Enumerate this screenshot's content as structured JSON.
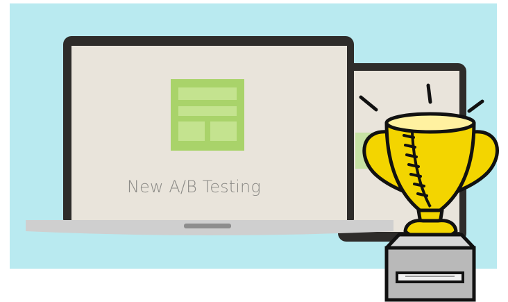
{
  "colors": {
    "sky": "#b9eaf0",
    "device_frame": "#2e2c2a",
    "screen": "#e9e4db",
    "laptop_base": "#cfcfcf",
    "template_green": "#a9d36a",
    "trophy_gold": "#f3d500",
    "trophy_outline": "#111111",
    "pedestal": "#b9b9b9"
  },
  "icons": [
    "laptop-icon",
    "tablet-icon",
    "page-template-icon",
    "trophy-icon"
  ],
  "screen": {
    "label": "New A/B Testing"
  }
}
